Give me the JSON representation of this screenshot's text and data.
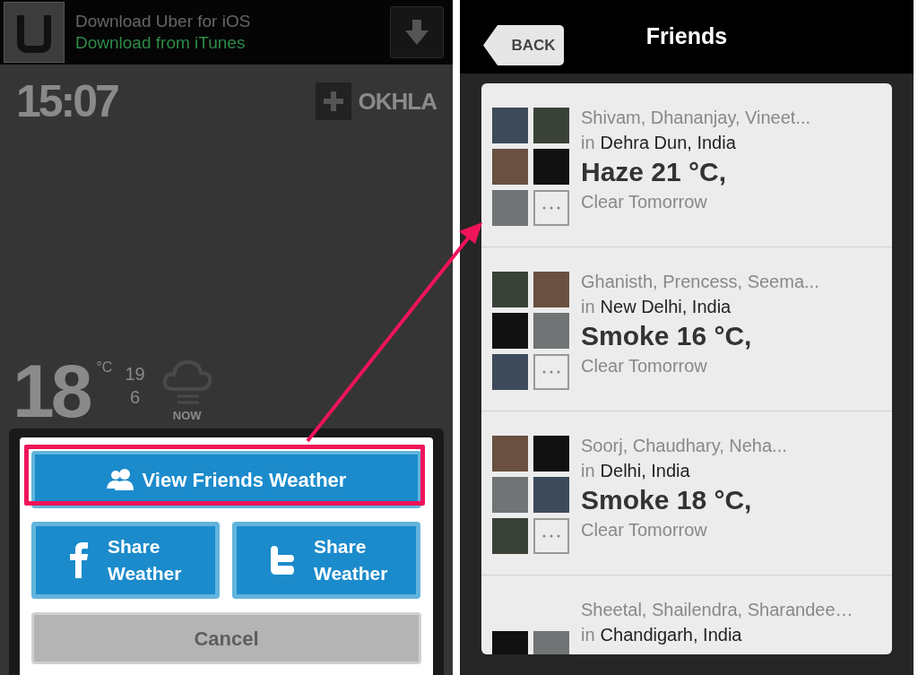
{
  "left_screen": {
    "banner": {
      "title": "Download Uber for iOS",
      "subtitle": "Download from iTunes"
    },
    "clock": {
      "time": "15:07",
      "location": "OKHLA"
    },
    "weather": {
      "temperature": "18",
      "unit": "°C",
      "high": "19",
      "low": "6",
      "period": "NOW"
    },
    "action_sheet": {
      "buttons": [
        {
          "kind": "friends",
          "label": "View Friends Weather"
        },
        {
          "kind": "facebook",
          "label": "Share Weather"
        },
        {
          "kind": "twitter",
          "label": "Share Weather"
        },
        {
          "kind": "cancel",
          "label": "Cancel"
        }
      ]
    }
  },
  "right_screen": {
    "back_button": "BACK",
    "title": "Friends",
    "groups": [
      {
        "names": "Shivam, Dhananjay, Vineet...",
        "prefix": "in",
        "location": "Dehra Dun, India",
        "weather": "Haze 21 °C,",
        "forecast": "Clear Tomorrow",
        "more": true
      },
      {
        "names": "Ghanisth, Prencess, Seema...",
        "prefix": "in",
        "location": "New Delhi, India",
        "weather": "Smoke 16 °C,",
        "forecast": "Clear Tomorrow",
        "more": true
      },
      {
        "names": "Soorj, Chaudhary, Neha...",
        "prefix": "in",
        "location": "Delhi, India",
        "weather": "Smoke 18 °C,",
        "forecast": "Clear Tomorrow",
        "more": true
      },
      {
        "names": "Sheetal, Shailendra, Sharandee…",
        "prefix": "in",
        "location": "Chandigarh, India",
        "more": false
      }
    ]
  }
}
